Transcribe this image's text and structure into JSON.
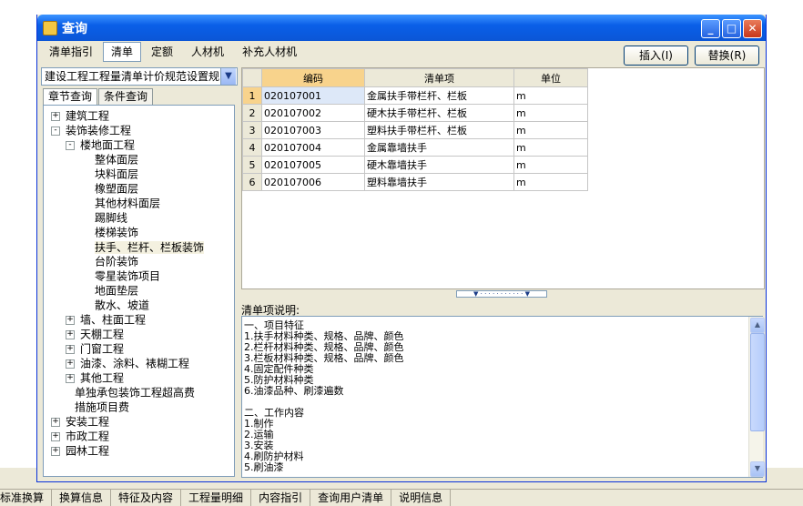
{
  "window": {
    "title": "查询",
    "tabs": [
      "清单指引",
      "清单",
      "定额",
      "人材机",
      "补充人材机"
    ],
    "active_tab": 1,
    "insert_button": "插入(I)",
    "replace_button": "替换(R)",
    "minimize_icon": "_",
    "maximize_icon": "□",
    "close_icon": "✕"
  },
  "left_panel": {
    "spec_select": "建设工程工程量清单计价规范设置规",
    "sub_tabs": [
      "章节查询",
      "条件查询"
    ],
    "tree": [
      {
        "label": "建筑工程",
        "level": 0,
        "expander": "+"
      },
      {
        "label": "装饰装修工程",
        "level": 0,
        "expander": "-"
      },
      {
        "label": "楼地面工程",
        "level": 1,
        "expander": "-"
      },
      {
        "label": "整体面层",
        "level": 2,
        "expander": ""
      },
      {
        "label": "块料面层",
        "level": 2,
        "expander": ""
      },
      {
        "label": "橡塑面层",
        "level": 2,
        "expander": ""
      },
      {
        "label": "其他材料面层",
        "level": 2,
        "expander": ""
      },
      {
        "label": "踢脚线",
        "level": 2,
        "expander": ""
      },
      {
        "label": "楼梯装饰",
        "level": 2,
        "expander": ""
      },
      {
        "label": "扶手、栏杆、栏板装饰",
        "level": 2,
        "expander": "",
        "selected": true
      },
      {
        "label": "台阶装饰",
        "level": 2,
        "expander": ""
      },
      {
        "label": "零星装饰项目",
        "level": 2,
        "expander": ""
      },
      {
        "label": "地面垫层",
        "level": 2,
        "expander": ""
      },
      {
        "label": "散水、坡道",
        "level": 2,
        "expander": ""
      },
      {
        "label": "墙、柱面工程",
        "level": 1,
        "expander": "+"
      },
      {
        "label": "天棚工程",
        "level": 1,
        "expander": "+"
      },
      {
        "label": "门窗工程",
        "level": 1,
        "expander": "+"
      },
      {
        "label": "油漆、涂料、裱糊工程",
        "level": 1,
        "expander": "+"
      },
      {
        "label": "其他工程",
        "level": 1,
        "expander": "+"
      },
      {
        "label": "单独承包装饰工程超高费",
        "level": 1,
        "expander": ""
      },
      {
        "label": "措施项目费",
        "level": 1,
        "expander": ""
      },
      {
        "label": "安装工程",
        "level": 0,
        "expander": "+"
      },
      {
        "label": "市政工程",
        "level": 0,
        "expander": "+"
      },
      {
        "label": "园林工程",
        "level": 0,
        "expander": "+"
      }
    ]
  },
  "grid": {
    "columns": [
      "编码",
      "清单项",
      "单位"
    ],
    "rows": [
      {
        "n": "1",
        "code": "020107001",
        "name": "金属扶手带栏杆、栏板",
        "unit": "m"
      },
      {
        "n": "2",
        "code": "020107002",
        "name": "硬木扶手带栏杆、栏板",
        "unit": "m"
      },
      {
        "n": "3",
        "code": "020107003",
        "name": "塑料扶手带栏杆、栏板",
        "unit": "m"
      },
      {
        "n": "4",
        "code": "020107004",
        "name": "金属靠墙扶手",
        "unit": "m"
      },
      {
        "n": "5",
        "code": "020107005",
        "name": "硬木靠墙扶手",
        "unit": "m"
      },
      {
        "n": "6",
        "code": "020107006",
        "name": "塑料靠墙扶手",
        "unit": "m"
      }
    ]
  },
  "description": {
    "label": "清单项说明:",
    "lines": [
      "一、项目特征",
      "1.扶手材料种类、规格、品牌、颜色",
      "2.栏杆材料种类、规格、品牌、颜色",
      "3.栏板材料种类、规格、品牌、颜色",
      "4.固定配件种类",
      "5.防护材料种类",
      "6.油漆品种、刷漆遍数",
      "",
      "二、工作内容",
      "1.制作",
      "2.运输",
      "3.安装",
      "4.刷防护材料",
      "5.刷油漆"
    ]
  },
  "bottom_tabs": [
    "标准换算",
    "换算信息",
    "特征及内容",
    "工程量明细",
    "内容指引",
    "查询用户清单",
    "说明信息"
  ]
}
